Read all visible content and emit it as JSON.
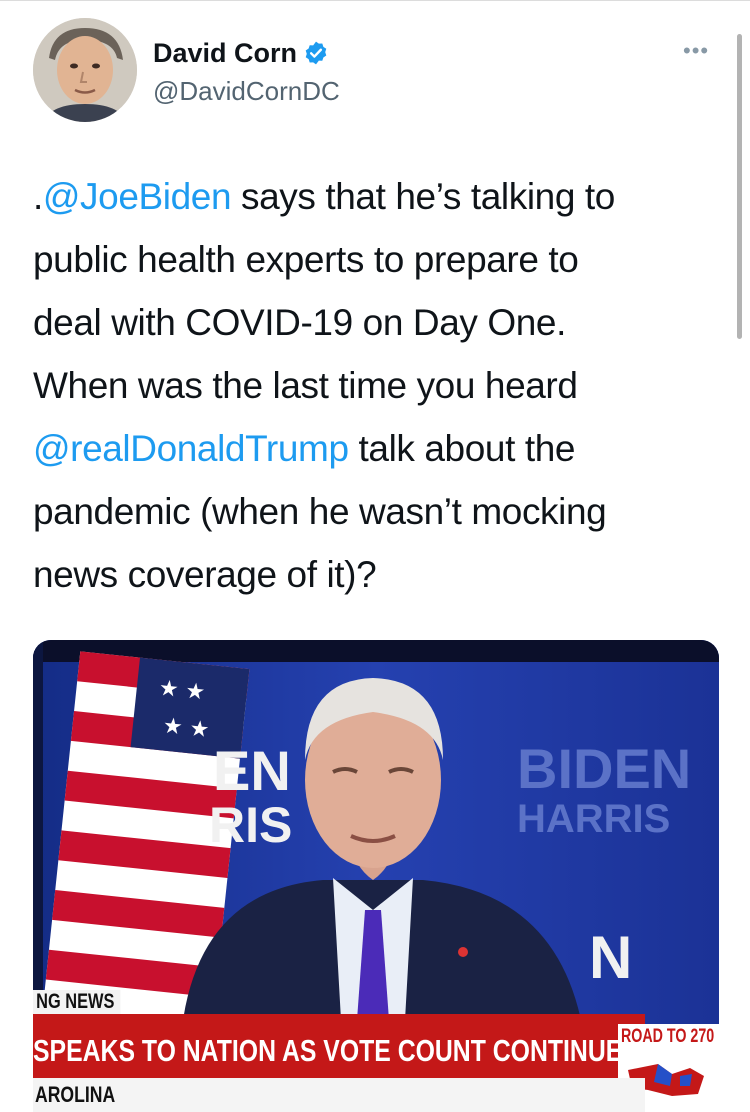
{
  "tweet": {
    "display_name": "David Corn",
    "handle": "@DavidCornDC",
    "more_icon": "ellipsis-icon",
    "text_segments": [
      {
        "text": ".",
        "kind": "plain"
      },
      {
        "text": "@JoeBiden",
        "kind": "mention"
      },
      {
        "text": " says that he’s talking to\npublic health experts to prepare to\ndeal with COVID-19 on Day One.\nWhen was the last time you heard\n",
        "kind": "plain"
      },
      {
        "text": "@realDonaldTrump",
        "kind": "mention"
      },
      {
        "text": " talk about the\npandemic (when he wasn’t mocking\nnews coverage of it)?",
        "kind": "plain"
      }
    ]
  },
  "media": {
    "backdrop_text_left_1": "EN",
    "backdrop_text_left_2": "RIS",
    "backdrop_text_right_1": "BIDEN",
    "backdrop_text_right_2": "HARRIS",
    "ticker_tag": "NG NEWS",
    "ticker_text": "SPEAKS TO NATION AS VOTE COUNT CONTINUES",
    "road_label": "ROAD TO 270",
    "lower_text": "AROLINA"
  },
  "colors": {
    "mention": "#1d9bf0",
    "verified": "#1d9bf0",
    "ticker_red": "#c41818",
    "backdrop_blue": "#1f3aa2"
  }
}
